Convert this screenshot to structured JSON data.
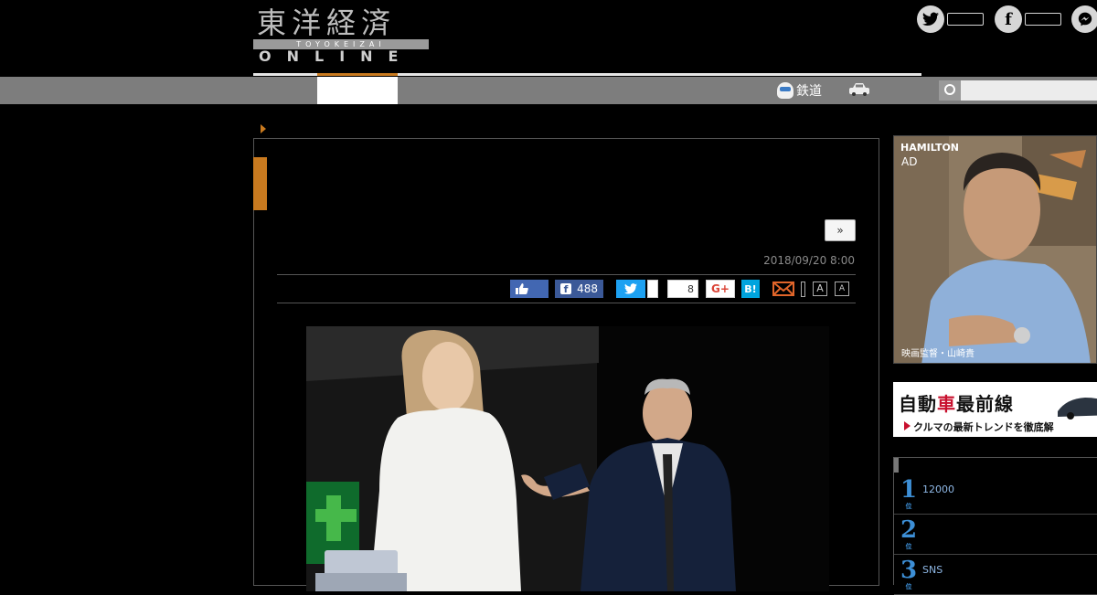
{
  "header": {
    "logo_kanji": "東洋経済",
    "logo_band": "TOYOKEIZAI",
    "logo_online": "ONLINE"
  },
  "social_icons": [
    "twitter-icon",
    "facebook-icon",
    "messenger-icon"
  ],
  "nav": {
    "rail_label": "鉄道",
    "search_placeholder": ""
  },
  "article": {
    "next_button": "»",
    "date": "2018/09/20 8:00",
    "share": {
      "facebook_count": "488",
      "pocket_count": "8",
      "gplus_label": "G+",
      "hatena_label": "B!",
      "font_large": "A",
      "font_small": "A"
    }
  },
  "sidebar": {
    "ad": {
      "brand": "HAMILTON",
      "label": "AD",
      "caption": "映画監督・山崎貴"
    },
    "car_banner": {
      "title_pre": "自動",
      "title_red": "車",
      "title_post": "最前線",
      "subtitle": "クルマの最新トレンドを徹底解"
    },
    "ranking": [
      {
        "rank": "1",
        "suffix": "位",
        "text": "12000"
      },
      {
        "rank": "2",
        "suffix": "位",
        "text": ""
      },
      {
        "rank": "3",
        "suffix": "位",
        "text": "SNS"
      }
    ]
  },
  "colors": {
    "accent": "#c97a1f",
    "nav_bar": "#7d7d7d",
    "rank_blue": "#3d8fd6",
    "facebook": "#3b5998",
    "twitter": "#1da1f2",
    "hatena": "#00a4de"
  }
}
